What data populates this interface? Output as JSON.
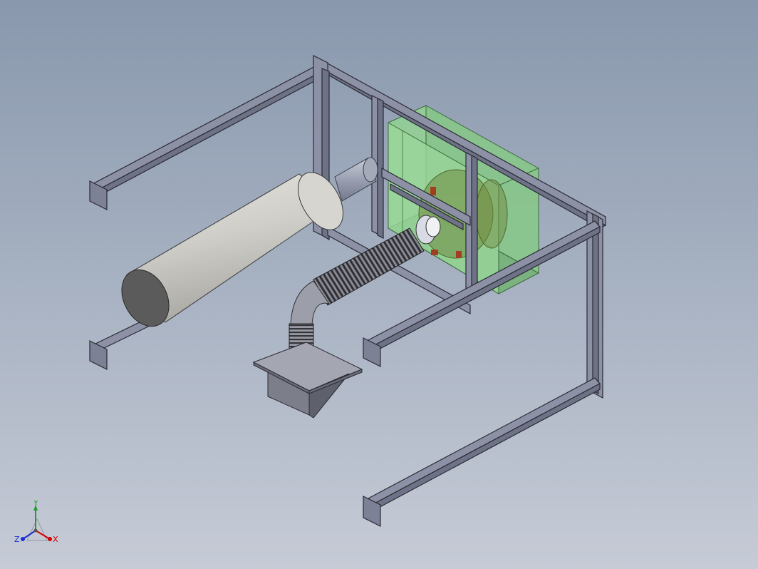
{
  "triad": {
    "x_label": "X",
    "y_label": "Y",
    "z_label": "Z",
    "x_color": "#d40000",
    "y_color": "#1fa02a",
    "z_color": "#1a2fcf"
  },
  "colors": {
    "background_top": "#8998ad",
    "background_bottom": "#c6cbd6",
    "frame": "#8d91a6",
    "frame_edge": "#2a2a33",
    "housing": "#7fc27f",
    "cylinder": "#cdccc8",
    "hose": "#5c5c66",
    "hopper": "#8e909a"
  }
}
